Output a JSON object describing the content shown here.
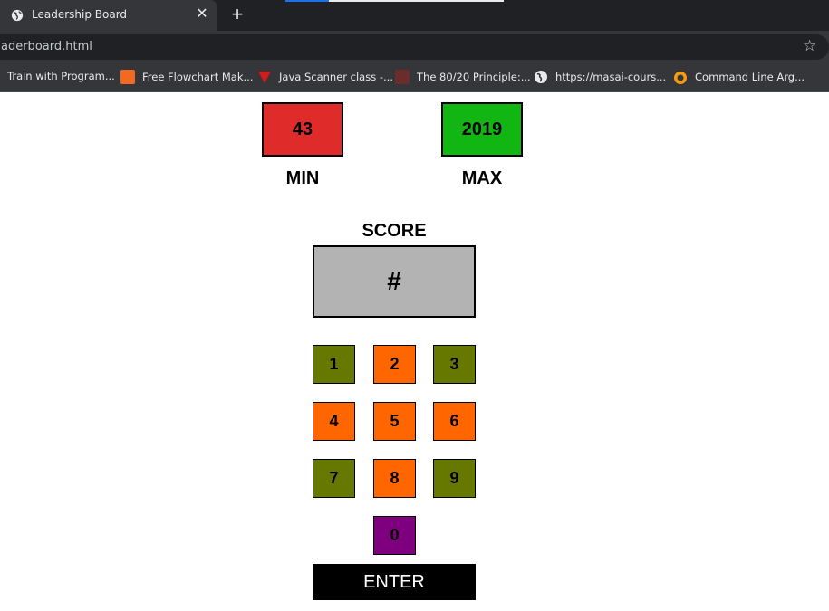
{
  "browser": {
    "tab_title": "Leadership Board",
    "tab_close": "✕",
    "new_tab": "+",
    "url": "aderboard.html",
    "bookmark_star": "☆",
    "bookmarks": [
      {
        "label": "Train with Program..."
      },
      {
        "label": "Free Flowchart Mak..."
      },
      {
        "label": "Java Scanner class -..."
      },
      {
        "label": "The 80/20 Principle:..."
      },
      {
        "label": "https://masai-cours..."
      },
      {
        "label": "Command Line Arg..."
      }
    ]
  },
  "stats": {
    "min": {
      "value": "43",
      "label": "MIN",
      "color": "#e02b2b"
    },
    "max": {
      "value": "2019",
      "label": "MAX",
      "color": "#12b612"
    }
  },
  "score": {
    "label": "SCORE",
    "value": "#"
  },
  "keypad": {
    "keys": [
      {
        "label": "1",
        "color": "#667800"
      },
      {
        "label": "2",
        "color": "#ff6600"
      },
      {
        "label": "3",
        "color": "#667800"
      },
      {
        "label": "4",
        "color": "#ff6600"
      },
      {
        "label": "5",
        "color": "#ff6600"
      },
      {
        "label": "6",
        "color": "#ff6600"
      },
      {
        "label": "7",
        "color": "#667800"
      },
      {
        "label": "8",
        "color": "#ff6600"
      },
      {
        "label": "9",
        "color": "#667800"
      },
      {
        "label": "0",
        "color": "#7f007f"
      }
    ],
    "enter_label": "ENTER"
  }
}
